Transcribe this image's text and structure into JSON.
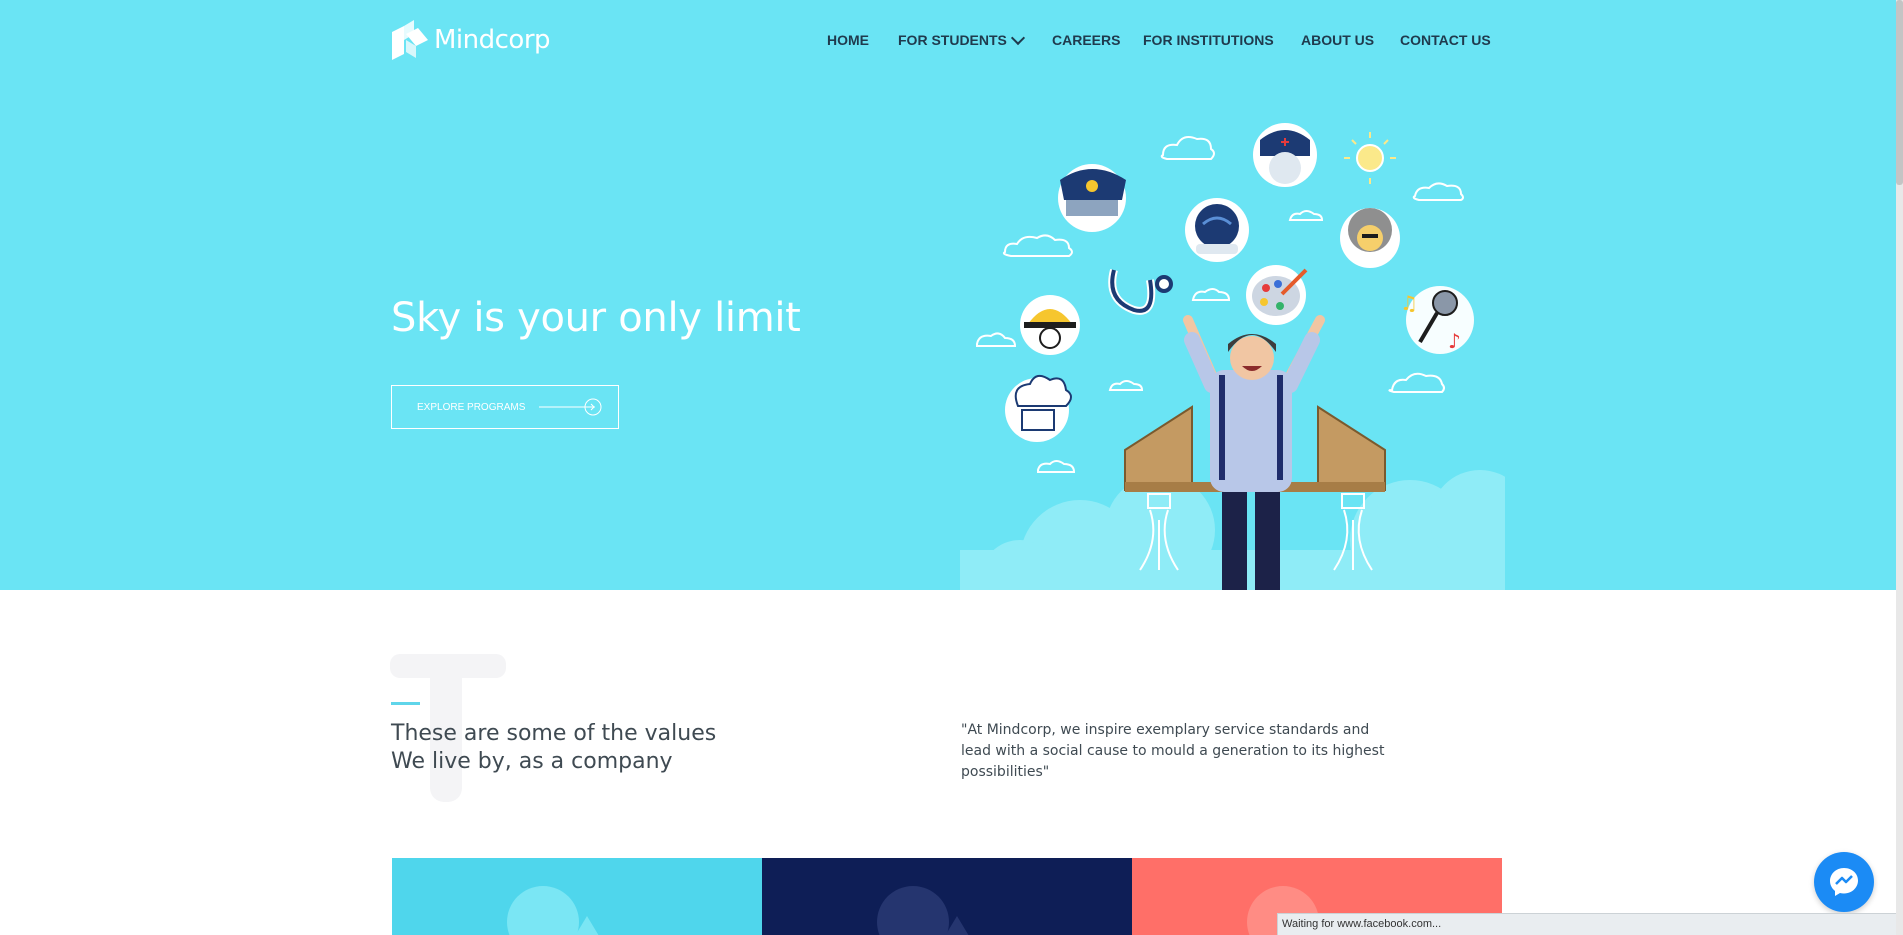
{
  "brand": {
    "name": "Mindcorp"
  },
  "nav": {
    "items": [
      {
        "label": "HOME"
      },
      {
        "label": "FOR STUDENTS"
      },
      {
        "label": "CAREERS"
      },
      {
        "label": "FOR INSTITUTIONS"
      },
      {
        "label": "ABOUT US"
      },
      {
        "label": "CONTACT US"
      }
    ]
  },
  "hero": {
    "title": "Sky is your only limit",
    "cta_label": "EXPLORE PROGRAMS"
  },
  "values": {
    "letter": "T",
    "heading_line1": "These are some of the values",
    "heading_line2": "We live by, as a company",
    "quote": "\"At Mindcorp, we inspire exemplary service standards and lead with a social cause to mould a generation to its highest possibilities\""
  },
  "status": {
    "text": "Waiting for www.facebook.com..."
  },
  "colors": {
    "hero_bg": "#6ae4f4",
    "nav_text": "#1f3a4d",
    "card_1": "#4fd6ec",
    "card_2": "#0e1e56",
    "card_3": "#ff6f68",
    "messenger": "#1b8bf5"
  },
  "icons": [
    "logo-icon",
    "chevron-down-icon",
    "arrow-circle-icon",
    "messenger-icon"
  ]
}
